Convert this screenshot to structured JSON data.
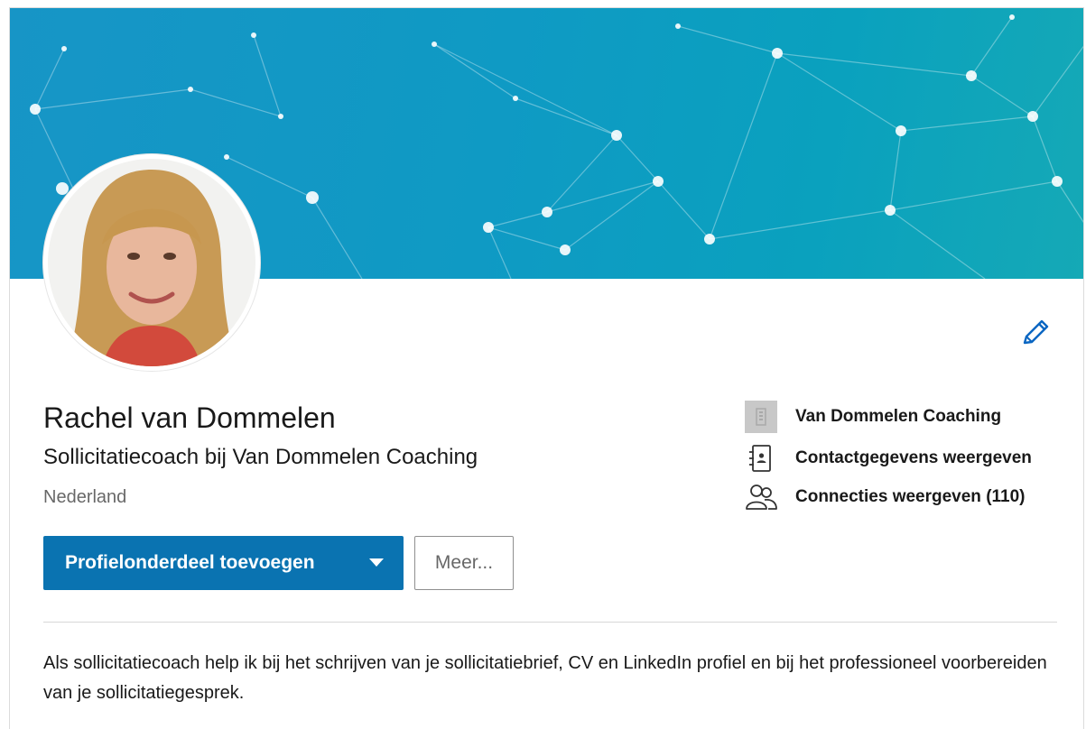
{
  "profile": {
    "name": "Rachel van Dommelen",
    "headline": "Sollicitatiecoach bij Van Dommelen Coaching",
    "location": "Nederland",
    "summary": "Als sollicitatiecoach help ik bij het schrijven van je sollicitatiebrief, CV en LinkedIn profiel en bij het professioneel voorbereiden van je sollicitatiegesprek."
  },
  "actions": {
    "add_section_label": "Profielonderdeel toevoegen",
    "more_label": "Meer..."
  },
  "sidebar_links": {
    "company": "Van Dommelen Coaching",
    "contact": "Contactgegevens weergeven",
    "connections": "Connecties weergeven (110)"
  },
  "icons": {
    "edit": "pencil-icon",
    "company": "building-icon",
    "contact": "address-book-icon",
    "connections": "people-icon",
    "add_section_caret": "caret-down-icon"
  },
  "colors": {
    "primary": "#0a73b1",
    "banner": "#0f9ac4",
    "link_icon": "#0a66c2"
  }
}
